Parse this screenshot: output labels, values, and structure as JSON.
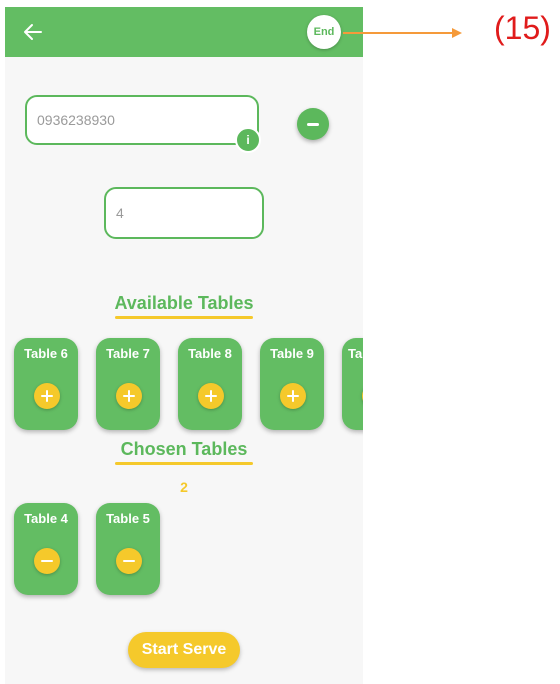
{
  "header": {
    "end_label": "End"
  },
  "phone_field": {
    "value": "0936238930",
    "info_icon": "i"
  },
  "guests_field": {
    "value": "4"
  },
  "available": {
    "title": "Available Tables",
    "tables": [
      "Table 6",
      "Table 7",
      "Table 8",
      "Table 9",
      "Ta"
    ]
  },
  "chosen": {
    "title": "Chosen Tables",
    "count": "2",
    "tables": [
      "Table 4",
      "Table 5"
    ]
  },
  "footer": {
    "start_label": "Start Serve"
  },
  "annotation": {
    "label": "(15)"
  },
  "colors": {
    "primary": "#5cb85c",
    "accent": "#f5c92b",
    "callout": "#f59a3a",
    "callout_text": "#e01b1b"
  }
}
